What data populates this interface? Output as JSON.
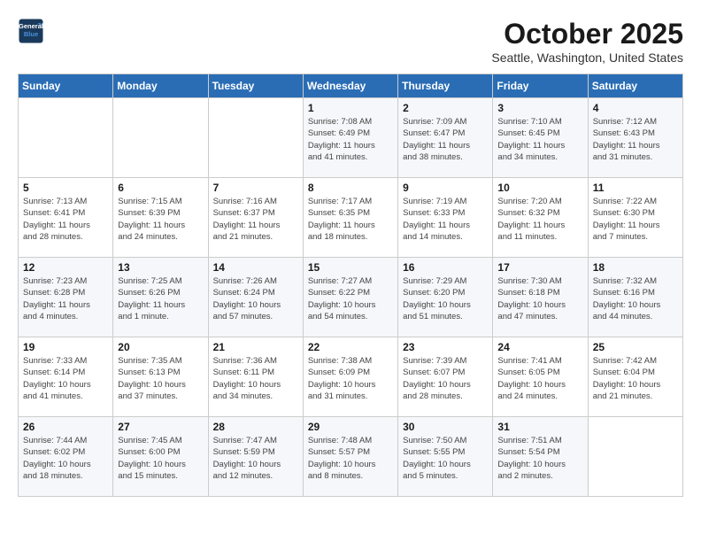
{
  "header": {
    "logo_line1": "General",
    "logo_line2": "Blue",
    "month": "October 2025",
    "location": "Seattle, Washington, United States"
  },
  "weekdays": [
    "Sunday",
    "Monday",
    "Tuesday",
    "Wednesday",
    "Thursday",
    "Friday",
    "Saturday"
  ],
  "weeks": [
    [
      {
        "day": "",
        "info": ""
      },
      {
        "day": "",
        "info": ""
      },
      {
        "day": "",
        "info": ""
      },
      {
        "day": "1",
        "info": "Sunrise: 7:08 AM\nSunset: 6:49 PM\nDaylight: 11 hours\nand 41 minutes."
      },
      {
        "day": "2",
        "info": "Sunrise: 7:09 AM\nSunset: 6:47 PM\nDaylight: 11 hours\nand 38 minutes."
      },
      {
        "day": "3",
        "info": "Sunrise: 7:10 AM\nSunset: 6:45 PM\nDaylight: 11 hours\nand 34 minutes."
      },
      {
        "day": "4",
        "info": "Sunrise: 7:12 AM\nSunset: 6:43 PM\nDaylight: 11 hours\nand 31 minutes."
      }
    ],
    [
      {
        "day": "5",
        "info": "Sunrise: 7:13 AM\nSunset: 6:41 PM\nDaylight: 11 hours\nand 28 minutes."
      },
      {
        "day": "6",
        "info": "Sunrise: 7:15 AM\nSunset: 6:39 PM\nDaylight: 11 hours\nand 24 minutes."
      },
      {
        "day": "7",
        "info": "Sunrise: 7:16 AM\nSunset: 6:37 PM\nDaylight: 11 hours\nand 21 minutes."
      },
      {
        "day": "8",
        "info": "Sunrise: 7:17 AM\nSunset: 6:35 PM\nDaylight: 11 hours\nand 18 minutes."
      },
      {
        "day": "9",
        "info": "Sunrise: 7:19 AM\nSunset: 6:33 PM\nDaylight: 11 hours\nand 14 minutes."
      },
      {
        "day": "10",
        "info": "Sunrise: 7:20 AM\nSunset: 6:32 PM\nDaylight: 11 hours\nand 11 minutes."
      },
      {
        "day": "11",
        "info": "Sunrise: 7:22 AM\nSunset: 6:30 PM\nDaylight: 11 hours\nand 7 minutes."
      }
    ],
    [
      {
        "day": "12",
        "info": "Sunrise: 7:23 AM\nSunset: 6:28 PM\nDaylight: 11 hours\nand 4 minutes."
      },
      {
        "day": "13",
        "info": "Sunrise: 7:25 AM\nSunset: 6:26 PM\nDaylight: 11 hours\nand 1 minute."
      },
      {
        "day": "14",
        "info": "Sunrise: 7:26 AM\nSunset: 6:24 PM\nDaylight: 10 hours\nand 57 minutes."
      },
      {
        "day": "15",
        "info": "Sunrise: 7:27 AM\nSunset: 6:22 PM\nDaylight: 10 hours\nand 54 minutes."
      },
      {
        "day": "16",
        "info": "Sunrise: 7:29 AM\nSunset: 6:20 PM\nDaylight: 10 hours\nand 51 minutes."
      },
      {
        "day": "17",
        "info": "Sunrise: 7:30 AM\nSunset: 6:18 PM\nDaylight: 10 hours\nand 47 minutes."
      },
      {
        "day": "18",
        "info": "Sunrise: 7:32 AM\nSunset: 6:16 PM\nDaylight: 10 hours\nand 44 minutes."
      }
    ],
    [
      {
        "day": "19",
        "info": "Sunrise: 7:33 AM\nSunset: 6:14 PM\nDaylight: 10 hours\nand 41 minutes."
      },
      {
        "day": "20",
        "info": "Sunrise: 7:35 AM\nSunset: 6:13 PM\nDaylight: 10 hours\nand 37 minutes."
      },
      {
        "day": "21",
        "info": "Sunrise: 7:36 AM\nSunset: 6:11 PM\nDaylight: 10 hours\nand 34 minutes."
      },
      {
        "day": "22",
        "info": "Sunrise: 7:38 AM\nSunset: 6:09 PM\nDaylight: 10 hours\nand 31 minutes."
      },
      {
        "day": "23",
        "info": "Sunrise: 7:39 AM\nSunset: 6:07 PM\nDaylight: 10 hours\nand 28 minutes."
      },
      {
        "day": "24",
        "info": "Sunrise: 7:41 AM\nSunset: 6:05 PM\nDaylight: 10 hours\nand 24 minutes."
      },
      {
        "day": "25",
        "info": "Sunrise: 7:42 AM\nSunset: 6:04 PM\nDaylight: 10 hours\nand 21 minutes."
      }
    ],
    [
      {
        "day": "26",
        "info": "Sunrise: 7:44 AM\nSunset: 6:02 PM\nDaylight: 10 hours\nand 18 minutes."
      },
      {
        "day": "27",
        "info": "Sunrise: 7:45 AM\nSunset: 6:00 PM\nDaylight: 10 hours\nand 15 minutes."
      },
      {
        "day": "28",
        "info": "Sunrise: 7:47 AM\nSunset: 5:59 PM\nDaylight: 10 hours\nand 12 minutes."
      },
      {
        "day": "29",
        "info": "Sunrise: 7:48 AM\nSunset: 5:57 PM\nDaylight: 10 hours\nand 8 minutes."
      },
      {
        "day": "30",
        "info": "Sunrise: 7:50 AM\nSunset: 5:55 PM\nDaylight: 10 hours\nand 5 minutes."
      },
      {
        "day": "31",
        "info": "Sunrise: 7:51 AM\nSunset: 5:54 PM\nDaylight: 10 hours\nand 2 minutes."
      },
      {
        "day": "",
        "info": ""
      }
    ]
  ]
}
